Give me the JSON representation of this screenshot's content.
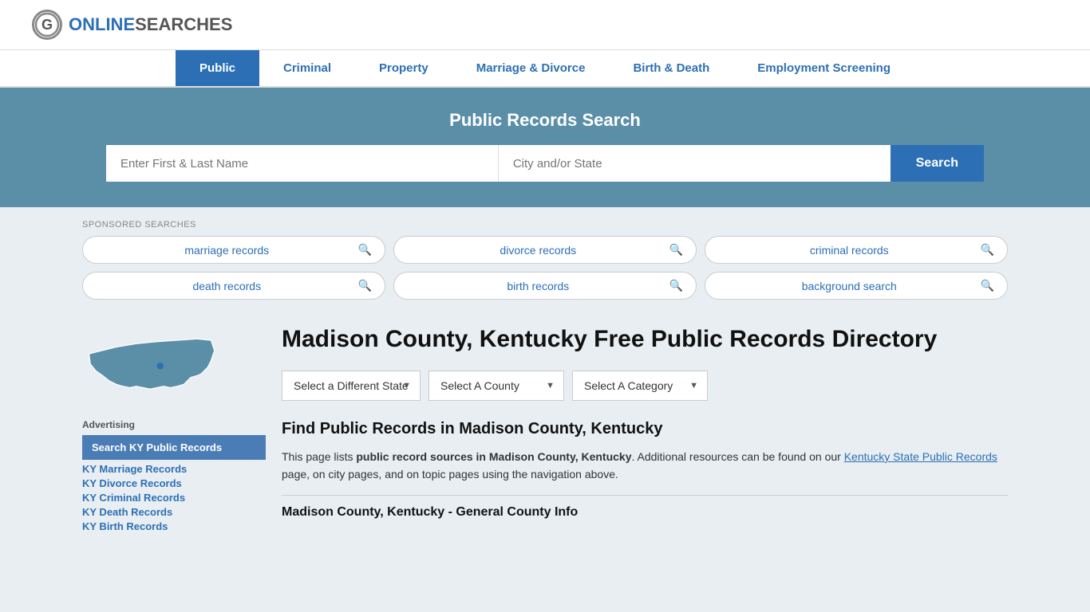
{
  "logo": {
    "icon_letter": "G",
    "brand_online": "ONLINE",
    "brand_searches": "SEARCHES"
  },
  "nav": {
    "items": [
      {
        "label": "Public",
        "active": true
      },
      {
        "label": "Criminal",
        "active": false
      },
      {
        "label": "Property",
        "active": false
      },
      {
        "label": "Marriage & Divorce",
        "active": false
      },
      {
        "label": "Birth & Death",
        "active": false
      },
      {
        "label": "Employment Screening",
        "active": false
      }
    ]
  },
  "hero": {
    "title": "Public Records Search",
    "name_placeholder": "Enter First & Last Name",
    "city_placeholder": "City and/or State",
    "search_label": "Search"
  },
  "sponsored": {
    "label": "SPONSORED SEARCHES",
    "items": [
      "marriage records",
      "divorce records",
      "criminal records",
      "death records",
      "birth records",
      "background search"
    ]
  },
  "page": {
    "title": "Madison County, Kentucky Free Public Records Directory",
    "dropdowns": {
      "state_label": "Select a Different State",
      "county_label": "Select A County",
      "category_label": "Select A Category"
    },
    "find_title": "Find Public Records in Madison County, Kentucky",
    "find_text_1": "This page lists ",
    "find_text_bold": "public record sources in Madison County, Kentucky",
    "find_text_2": ". Additional resources can be found on our ",
    "find_link": "Kentucky State Public Records",
    "find_text_3": " page, on city pages, and on topic pages using the navigation above.",
    "county_info_title": "Madison County, Kentucky - General County Info"
  },
  "sidebar": {
    "advertising_label": "Advertising",
    "highlight_label": "Search KY Public Records",
    "links": [
      "KY Marriage Records",
      "KY Divorce Records",
      "KY Criminal Records",
      "KY Death Records",
      "KY Birth Records"
    ]
  },
  "colors": {
    "blue": "#2c6fb5",
    "teal": "#5b8fa8",
    "nav_active": "#2c6fb5",
    "ky_map": "#5b8fa8"
  }
}
